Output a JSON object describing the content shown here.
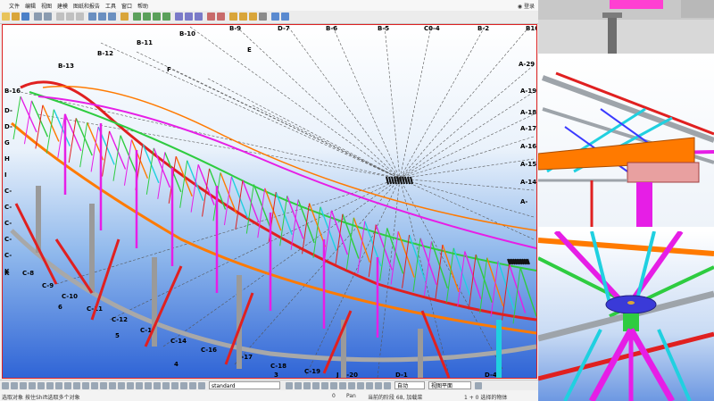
{
  "menu": {
    "items": [
      "文件",
      "编辑",
      "视图",
      "建模",
      "图纸和报告",
      "工具",
      "窗口",
      "帮助"
    ],
    "login": "登录"
  },
  "grid_labels": {
    "top": [
      "B-10",
      "B-9",
      "D-7",
      "B-6",
      "B-5",
      "C0-4",
      "B-2",
      "B10"
    ],
    "left_upper": [
      "B-11",
      "B-12",
      "B-13",
      "B-16",
      "F",
      "E"
    ],
    "left_edge": [
      "D-",
      "D-",
      "G",
      "H",
      "I",
      "C-",
      "C-",
      "C-",
      "C-",
      "C-",
      "K"
    ],
    "right_edge": [
      "A-29",
      "A-19",
      "A-18",
      "A-17",
      "A-16",
      "A-15",
      "A-14",
      "A-"
    ],
    "bottom_c": [
      "C-8",
      "C-9",
      "C-10",
      "C-11",
      "C-12",
      "C-13",
      "C-14",
      "C-16",
      "C-17",
      "C-18",
      "C-19",
      "C-20",
      "D-1",
      "D-4"
    ],
    "bottom_num": [
      "6",
      "5",
      "4",
      "3",
      "J"
    ],
    "bottom_k": "K"
  },
  "bottom_toolbar": {
    "view_select": "standard",
    "snap_select": "自动",
    "plane_select": "视图平面"
  },
  "status": {
    "left": "选取对象",
    "hint": "按住Shift选取多个对象",
    "coord": "0",
    "mode": "Pan",
    "current_phase": "当前的阶段 68, 加载菜",
    "selected": "1 + 0 选择的物体"
  },
  "colors": {
    "magenta": "#e61ee6",
    "red": "#e02020",
    "orange": "#ff7a00",
    "green": "#2ecc40",
    "cyan": "#20d0e0",
    "gray": "#a8a8a8",
    "viewport_border": "#dd2222"
  }
}
